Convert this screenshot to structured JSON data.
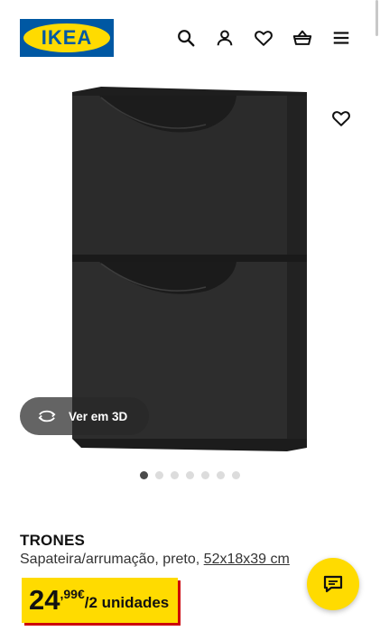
{
  "header": {
    "logo_text": "IKEA",
    "icons": [
      "search-icon",
      "user-icon",
      "heart-icon",
      "basket-icon",
      "menu-icon"
    ]
  },
  "gallery": {
    "view_3d_label": "Ver em 3D",
    "total_images": 7,
    "active_index": 0
  },
  "product": {
    "name": "TRONES",
    "description": "Sapateira/arrumação, preto,",
    "dimensions": "52x18x39 cm",
    "price_integer": "24",
    "price_decimal": ",99€",
    "price_unit": "/2 unidades"
  },
  "colors": {
    "brand_blue": "#0058a3",
    "brand_yellow": "#ffdb00",
    "price_shadow_red": "#cc0008"
  }
}
